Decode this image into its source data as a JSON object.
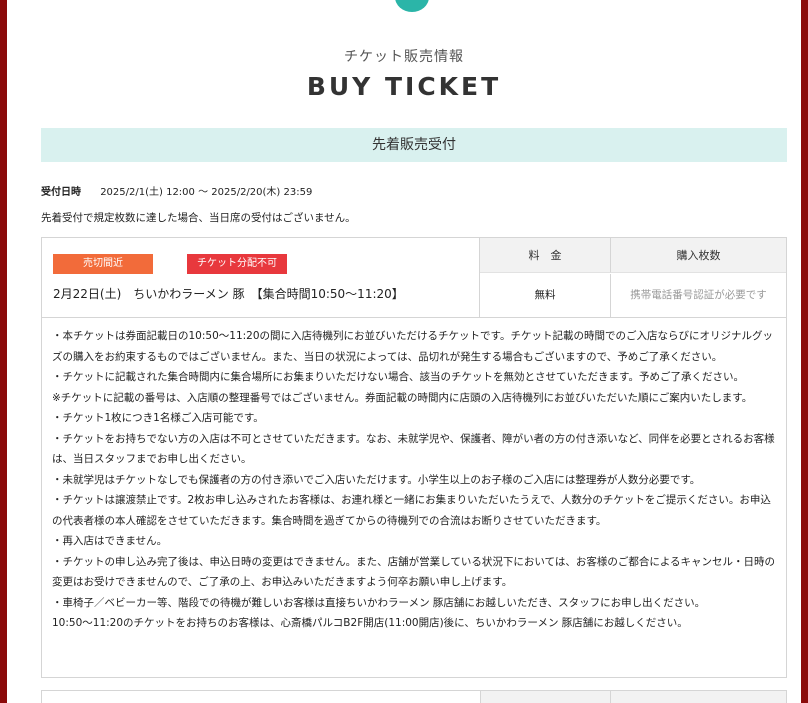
{
  "header": {
    "subtitle": "チケット販売情報",
    "title": "BUY TICKET"
  },
  "section": {
    "title": "先着販売受付"
  },
  "period": {
    "label": "受付日時",
    "value": "2025/2/1(土) 12:00 〜 2025/2/20(木) 23:59"
  },
  "notice": "先着受付で規定枚数に達した場合、当日席の受付はございません。",
  "ticket": {
    "badge_soldout": "売切間近",
    "badge_nodist": "チケット分配不可",
    "name": "2月22日(土)　ちいかわラーメン 豚　【集合時間10:50〜11:20】",
    "price_header": "料　金",
    "qty_header": "購入枚数",
    "price_value": "無料",
    "qty_value": "携帯電話番号認証が必要です",
    "notes": [
      "・本チケットは券面記載日の10:50〜11:20の間に入店待機列にお並びいただけるチケットです。チケット記載の時間でのご入店ならびにオリジナルグッズの購入をお約束するものではございません。また、当日の状況によっては、品切れが発生する場合もございますので、予めご了承ください。",
      "・チケットに記載された集合時間内に集合場所にお集まりいただけない場合、該当のチケットを無効とさせていただきます。予めご了承ください。",
      "※チケットに記載の番号は、入店順の整理番号ではございません。券面記載の時間内に店頭の入店待機列にお並びいただいた順にご案内いたします。",
      "・チケット1枚につき1名様ご入店可能です。",
      "・チケットをお持ちでない方の入店は不可とさせていただきます。なお、未就学児や、保護者、障がい者の方の付き添いなど、同伴を必要とされるお客様は、当日スタッフまでお申し出ください。",
      "・未就学児はチケットなしでも保護者の方の付き添いでご入店いただけます。小学生以上のお子様のご入店には整理券が人数分必要です。",
      "・チケットは譲渡禁止です。2枚お申し込みされたお客様は、お連れ様と一緒にお集まりいただいたうえで、人数分のチケットをご提示ください。お申込の代表者様の本人確認をさせていただきます。集合時間を過ぎてからの待機列での合流はお断りさせていただきます。",
      "・再入店はできません。",
      "・チケットの申し込み完了後は、申込日時の変更はできません。また、店舗が営業している状況下においては、お客様のご都合によるキャンセル・日時の変更はお受けできませんので、ご了承の上、お申込みいただきますよう何卒お願い申し上げます。",
      "・車椅子／ベビーカー等、階段での待機が難しいお客様は直接ちいかわラーメン 豚店舗にお越しいただき、スタッフにお申し出ください。",
      "10:50〜11:20のチケットをお持ちのお客様は、心斎橋パルコB2F開店(11:00開店)後に、ちいかわラーメン 豚店舗にお越しください。"
    ]
  },
  "colors": {
    "border": "#8b0a0a",
    "accent": "#2bb5a8",
    "band": "#d9f1ef",
    "badge_soldout": "#f26b3a",
    "badge_nodist": "#e8383d"
  }
}
